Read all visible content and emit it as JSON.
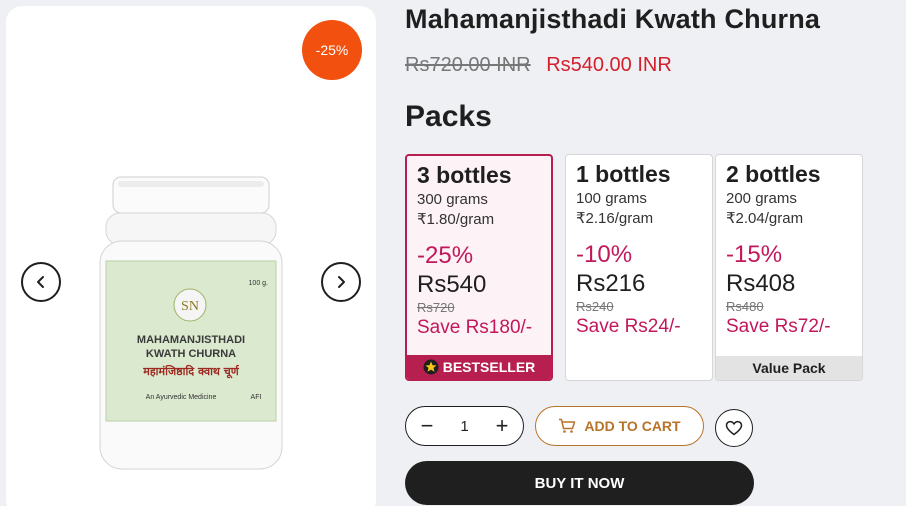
{
  "product": {
    "title": "Mahamanjisthadi Kwath Churna",
    "old_price": "Rs720.00 INR",
    "new_price": "Rs540.00 INR",
    "discount_badge": "-25%"
  },
  "label": {
    "brand_mark": "SN",
    "line1": "MAHAMANJISTHADI",
    "line2": "KWATH CHURNA",
    "hindi": "महामंजिष्ठादि क्वाथ चूर्ण",
    "weight": "100 g.",
    "tagline": "An Ayurvedic Medicine",
    "code": "AFI"
  },
  "packs_heading": "Packs",
  "packs": [
    {
      "title": "3 bottles",
      "grams": "300 grams",
      "rate": "₹1.80/gram",
      "pct": "-25%",
      "amount": "Rs540",
      "strike": "Rs720",
      "save": "Save Rs180/-",
      "tag": "BESTSELLER"
    },
    {
      "title": "1 bottles",
      "grams": "100 grams",
      "rate": "₹2.16/gram",
      "pct": "-10%",
      "amount": "Rs216",
      "strike": "Rs240",
      "save": "Save Rs24/-"
    },
    {
      "title": "2 bottles",
      "grams": "200 grams",
      "rate": "₹2.04/gram",
      "pct": "-15%",
      "amount": "Rs408",
      "strike": "Rs480",
      "save": "Save Rs72/-",
      "tag": "Value Pack"
    }
  ],
  "quantity": {
    "minus": "−",
    "value": "1",
    "plus": "+"
  },
  "buttons": {
    "add_to_cart": "ADD TO CART",
    "buy_now": "BUY IT NOW"
  },
  "colors": {
    "accent": "#b61f4f",
    "discount": "#f2500f",
    "cart": "#b8732a",
    "price": "#d41f2c"
  },
  "icons": {
    "prev": "chevron-left-icon",
    "next": "chevron-right-icon",
    "cart": "cart-icon",
    "wishlist": "heart-icon",
    "bestseller": "star-icon"
  }
}
